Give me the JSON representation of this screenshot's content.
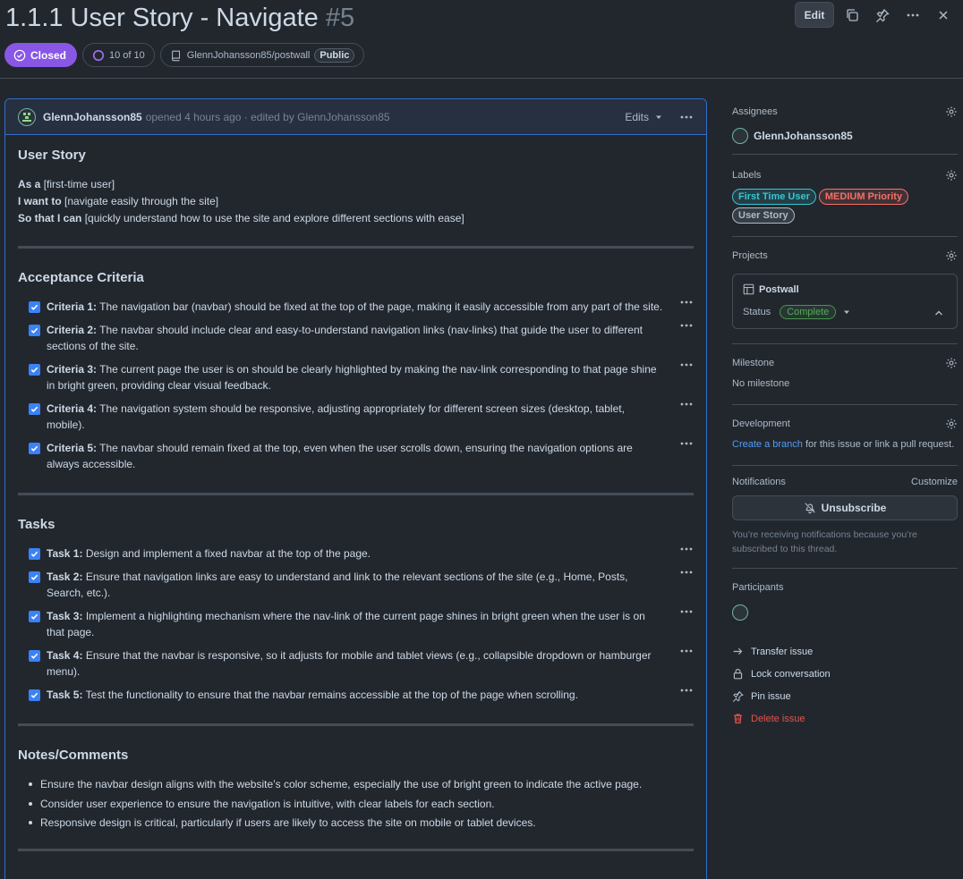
{
  "issue": {
    "title": "1.1.1 User Story - Navigate",
    "number": "#5",
    "state": "Closed",
    "progress": "10 of 10",
    "repo": "GlennJohansson85/postwall",
    "visibility": "Public",
    "edit_label": "Edit"
  },
  "comment": {
    "author": "GlennJohansson85",
    "meta": "opened 4 hours ago · edited by GlennJohansson85",
    "edits_label": "Edits",
    "story_heading": "User Story",
    "story": {
      "as_a_label": "As a",
      "as_a_value": "[first-time user]",
      "want_label": "I want to",
      "want_value": "[navigate easily through the site]",
      "so_label": "So that I can",
      "so_value": "[quickly understand how to use the site and explore different sections with ease]"
    },
    "criteria_heading": "Acceptance Criteria",
    "criteria": [
      {
        "label": "Criteria 1:",
        "text": "The navigation bar (navbar) should be fixed at the top of the page, making it easily accessible from any part of the site."
      },
      {
        "label": "Criteria 2:",
        "text": "The navbar should include clear and easy-to-understand navigation links (nav-links) that guide the user to different sections of the site."
      },
      {
        "label": "Criteria 3:",
        "text": "The current page the user is on should be clearly highlighted by making the nav-link corresponding to that page shine in bright green, providing clear visual feedback."
      },
      {
        "label": "Criteria 4:",
        "text": "The navigation system should be responsive, adjusting appropriately for different screen sizes (desktop, tablet, mobile)."
      },
      {
        "label": "Criteria 5:",
        "text": "The navbar should remain fixed at the top, even when the user scrolls down, ensuring the navigation options are always accessible."
      }
    ],
    "tasks_heading": "Tasks",
    "tasks": [
      {
        "label": "Task 1:",
        "text": "Design and implement a fixed navbar at the top of the page."
      },
      {
        "label": "Task 2:",
        "text": "Ensure that navigation links are easy to understand and link to the relevant sections of the site (e.g., Home, Posts, Search, etc.)."
      },
      {
        "label": "Task 3:",
        "text": "Implement a highlighting mechanism where the nav-link of the current page shines in bright green when the user is on that page."
      },
      {
        "label": "Task 4:",
        "text": "Ensure that the navbar is responsive, so it adjusts for mobile and tablet views (e.g., collapsible dropdown or hamburger menu)."
      },
      {
        "label": "Task 5:",
        "text": "Test the functionality to ensure that the navbar remains accessible at the top of the page when scrolling."
      }
    ],
    "notes_heading": "Notes/Comments",
    "notes": [
      "Ensure the navbar design aligns with the website’s color scheme, especially the use of bright green to indicate the active page.",
      "Consider user experience to ensure the navigation is intuitive, with clear labels for each section.",
      "Responsive design is critical, particularly if users are likely to access the site on mobile or tablet devices."
    ]
  },
  "sidebar": {
    "assignees_title": "Assignees",
    "assignee": "GlennJohansson85",
    "labels_title": "Labels",
    "labels": [
      {
        "text": "First Time User",
        "color": "#39c5cf"
      },
      {
        "text": "MEDIUM Priority",
        "color": "#f47067"
      },
      {
        "text": "User Story",
        "color": "#adbac7"
      }
    ],
    "projects_title": "Projects",
    "project_name": "Postwall",
    "status_label": "Status",
    "status_value": "Complete",
    "milestone_title": "Milestone",
    "milestone_value": "No milestone",
    "development_title": "Development",
    "dev_link": "Create a branch",
    "dev_text": " for this issue or link a pull request.",
    "notifications_title": "Notifications",
    "customize_label": "Customize",
    "unsubscribe_label": "Unsubscribe",
    "notif_reason": "You’re receiving notifications because you’re subscribed to this thread.",
    "participants_title": "Participants",
    "actions": {
      "transfer": "Transfer issue",
      "lock": "Lock conversation",
      "pin": "Pin issue",
      "delete": "Delete issue"
    }
  },
  "colors": {
    "closed": "#8957e5",
    "accent_border": "#316dca",
    "checkbox": "#3b82f6",
    "danger": "#e5534b",
    "link": "#539bf5"
  }
}
